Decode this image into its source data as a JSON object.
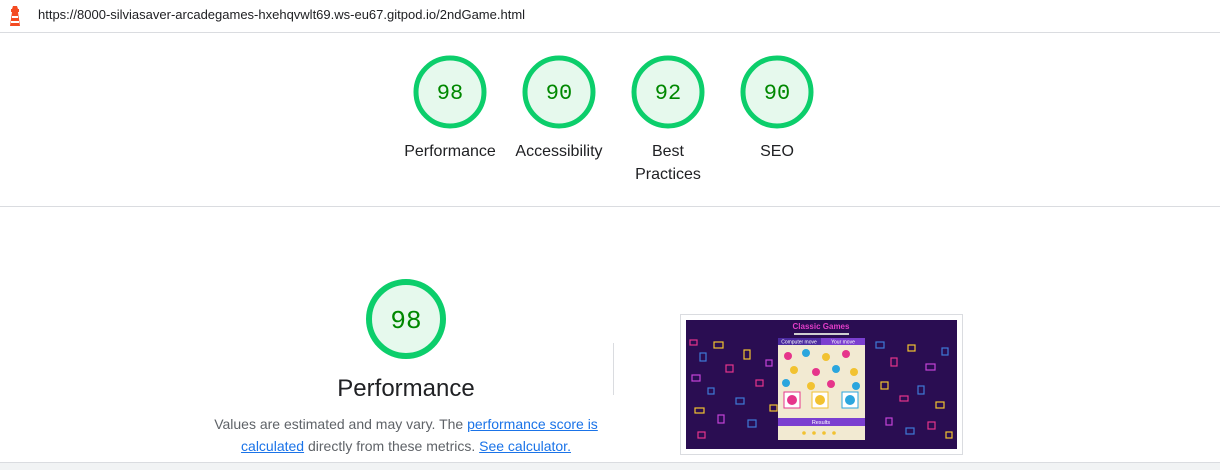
{
  "browser": {
    "url": "https://8000-silviasaver-arcadegames-hxehqvwlt69.ws-eu67.gitpod.io/2ndGame.html"
  },
  "summary_scores": [
    {
      "score": "98",
      "label": "Performance"
    },
    {
      "score": "90",
      "label": "Accessibility"
    },
    {
      "score": "92",
      "label": "Best Practices"
    },
    {
      "score": "90",
      "label": "SEO"
    }
  ],
  "performance": {
    "score": "98",
    "title": "Performance",
    "desc_prefix": "Values are estimated and may vary. The ",
    "link_score": "performance score is calculated",
    "desc_middle": " directly from these metrics. ",
    "link_calculator": "See calculator."
  },
  "screenshot": {
    "title": "Classic Games",
    "computer_move": "Computer move",
    "your_move": "Your move",
    "results": "Results"
  },
  "colors": {
    "pass_ring": "#0cce6b",
    "pass_text": "#008800",
    "pass_fill": "#e6f9ed",
    "link": "#1a73e8"
  },
  "icons": {
    "lighthouse": "lighthouse-icon"
  }
}
